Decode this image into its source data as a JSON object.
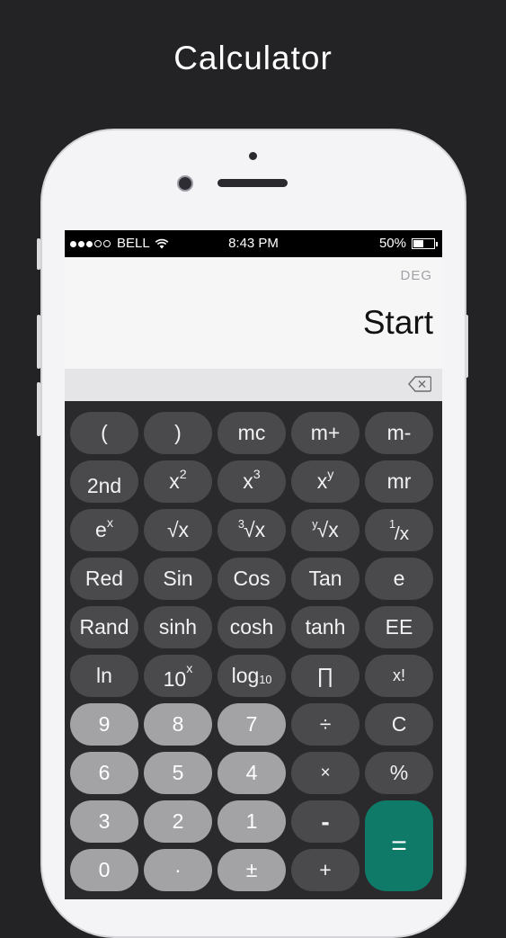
{
  "headline": "Calculator",
  "status_bar": {
    "carrier": "BELL",
    "time": "8:43 PM",
    "battery_percent": "50%",
    "battery_level": 0.5,
    "signal_dots_filled": 3,
    "signal_dots_total": 5
  },
  "display": {
    "angle_mode": "DEG",
    "value": "Start"
  },
  "keys": {
    "paren_open": "(",
    "paren_close": ")",
    "mc": "mc",
    "m_plus": "m+",
    "m_minus": "m-",
    "second": "2nd",
    "x_squared_base": "x",
    "x_squared_exp": "2",
    "x_cubed_base": "x",
    "x_cubed_exp": "3",
    "x_pow_y_base": "x",
    "x_pow_y_exp": "y",
    "mr": "mr",
    "e_pow_x_base": "e",
    "e_pow_x_exp": "x",
    "sqrt": "√x",
    "cbrt_index": "3",
    "cbrt_body": "√x",
    "yrt_index": "y",
    "yrt_body": "√x",
    "reciprocal_num": "1",
    "reciprocal_den": "/x",
    "rad": "Red",
    "sin": "Sin",
    "cos": "Cos",
    "tan": "Tan",
    "e": "e",
    "rand": "Rand",
    "sinh": "sinh",
    "cosh": "cosh",
    "tanh": "tanh",
    "ee": "EE",
    "ln": "ln",
    "ten_pow_x_base": "10",
    "ten_pow_x_exp": "x",
    "log_base": "log",
    "log_sub": "10",
    "pi": "∏",
    "factorial": "x!",
    "d9": "9",
    "d8": "8",
    "d7": "7",
    "divide": "÷",
    "clear": "C",
    "d6": "6",
    "d5": "5",
    "d4": "4",
    "multiply": "×",
    "percent": "%",
    "d3": "3",
    "d2": "2",
    "d1": "1",
    "minus": "-",
    "equals": "=",
    "d0": "0",
    "decimal": "·",
    "plus_minus": "±",
    "plus": "+"
  },
  "colors": {
    "background": "#232224",
    "function_key": "#4a494c",
    "number_key": "#a3a3a6",
    "equals_key": "#0e7a67",
    "display_bg": "#f7f6f7"
  },
  "icons": {
    "wifi": "wifi-icon",
    "battery": "battery-icon",
    "backspace": "backspace-icon"
  }
}
